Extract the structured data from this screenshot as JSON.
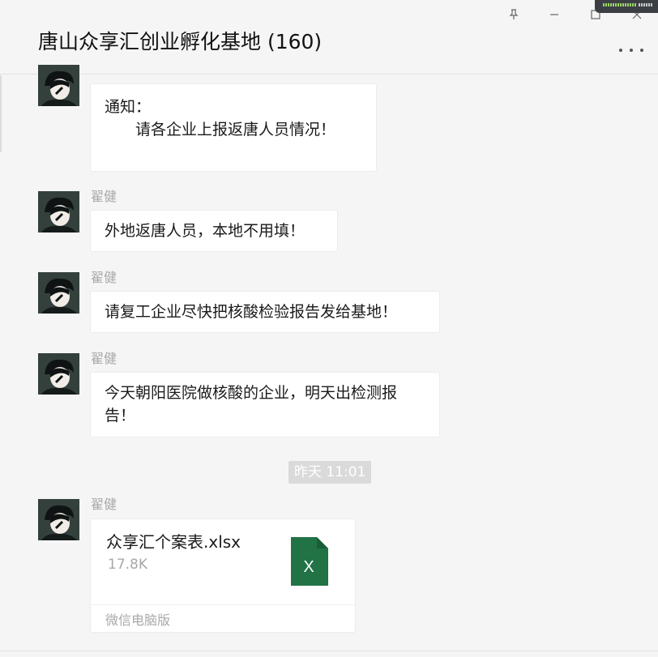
{
  "window": {
    "title": "唐山众享汇创业孵化基地 (160)"
  },
  "controls": {
    "pin_icon": "pin-icon",
    "minimize_icon": "minimize-icon",
    "maximize_icon": "maximize-icon",
    "close_icon": "close-icon",
    "more_icon": "more-dots-icon"
  },
  "messages": [
    {
      "sender": "",
      "lines": [
        "通知：",
        "　　请各企业上报返唐人员情况！"
      ]
    },
    {
      "sender": "翟健",
      "lines": [
        "外地返唐人员，本地不用填！"
      ]
    },
    {
      "sender": "翟健",
      "lines": [
        "请复工企业尽快把核酸检验报告发给基地！"
      ]
    },
    {
      "sender": "翟健",
      "lines": [
        "今天朝阳医院做核酸的企业，明天出检测报",
        "告！"
      ]
    }
  ],
  "timestamp": "昨天 11:01",
  "file_message": {
    "sender": "翟健",
    "file_name": "众享汇个案表.xlsx",
    "file_size": "17.8K",
    "source": "微信电脑版",
    "file_icon_letter": "X",
    "file_icon_color": "#217346"
  }
}
